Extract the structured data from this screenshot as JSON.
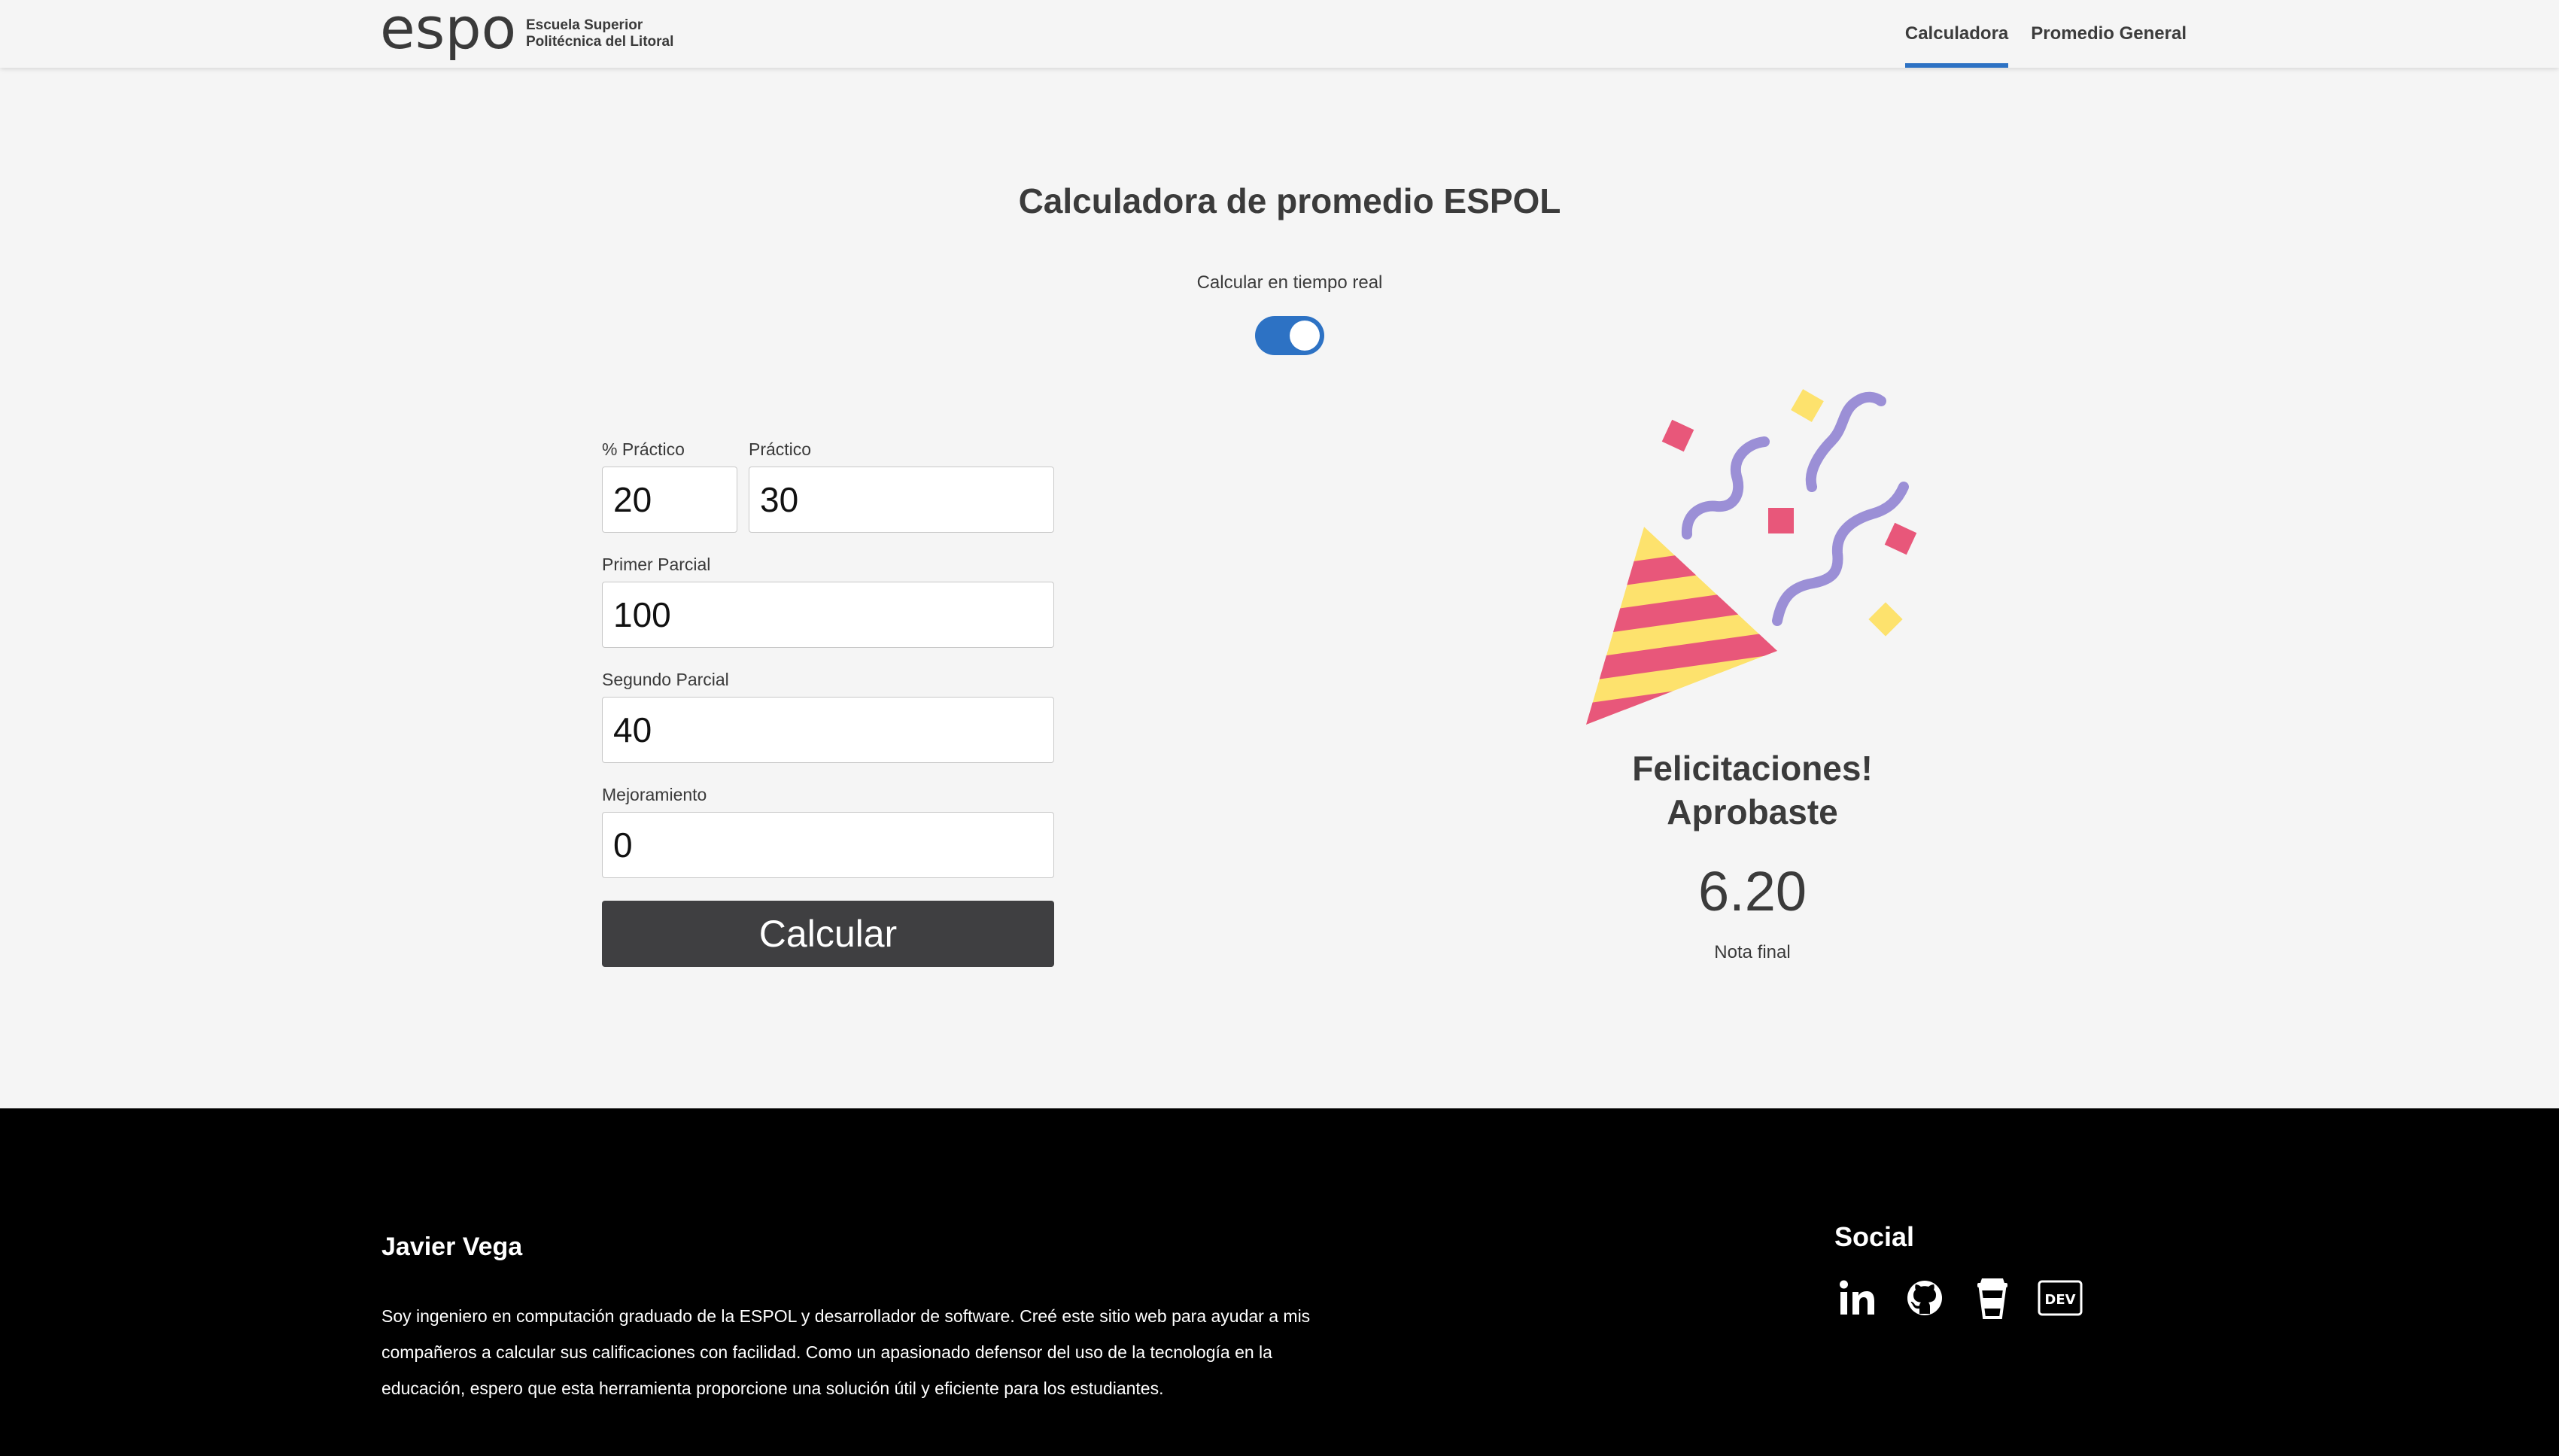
{
  "brand": {
    "logo_word": "espol",
    "name_line1": "Escuela Superior",
    "name_line2": "Politécnica del Litoral"
  },
  "nav": {
    "items": [
      {
        "label": "Calculadora",
        "active": true
      },
      {
        "label": "Promedio General",
        "active": false
      }
    ]
  },
  "calculator": {
    "title": "Calculadora de promedio ESPOL",
    "realtime_label": "Calcular en tiempo real",
    "realtime_enabled": true,
    "fields": {
      "pct_practico": {
        "label": "% Práctico",
        "value": "20"
      },
      "practico": {
        "label": "Práctico",
        "value": "30"
      },
      "primer_parcial": {
        "label": "Primer Parcial",
        "value": "100"
      },
      "segundo_parcial": {
        "label": "Segundo Parcial",
        "value": "40"
      },
      "mejoramiento": {
        "label": "Mejoramiento",
        "value": "0"
      }
    },
    "button_label": "Calcular"
  },
  "result": {
    "icon": "party-popper-icon",
    "message_line1": "Felicitaciones!",
    "message_line2": "Aprobaste",
    "grade": "6.20",
    "grade_label": "Nota final"
  },
  "footer": {
    "author": "Javier Vega",
    "bio": "Soy ingeniero en computación graduado de la ESPOL y desarrollador de software. Creé este sitio web para ayudar a mis compañeros a calcular sus calificaciones con facilidad. Como un apasionado defensor del uso de la tecnología en la educación, espero que esta herramienta proporcione una solución útil y eficiente para los estudiantes.",
    "social_title": "Social",
    "social_icons": [
      "linkedin-icon",
      "github-icon",
      "buy-me-a-coffee-icon",
      "dev-icon"
    ],
    "dev_label": "DEV"
  },
  "colors": {
    "accent": "#2d72c4",
    "button": "#3f3f41",
    "background": "#f5f5f5",
    "footer": "#000000",
    "confetti_pink": "#e8577a",
    "confetti_yellow": "#fde26d",
    "streamer_purple": "#9b8fd6"
  }
}
